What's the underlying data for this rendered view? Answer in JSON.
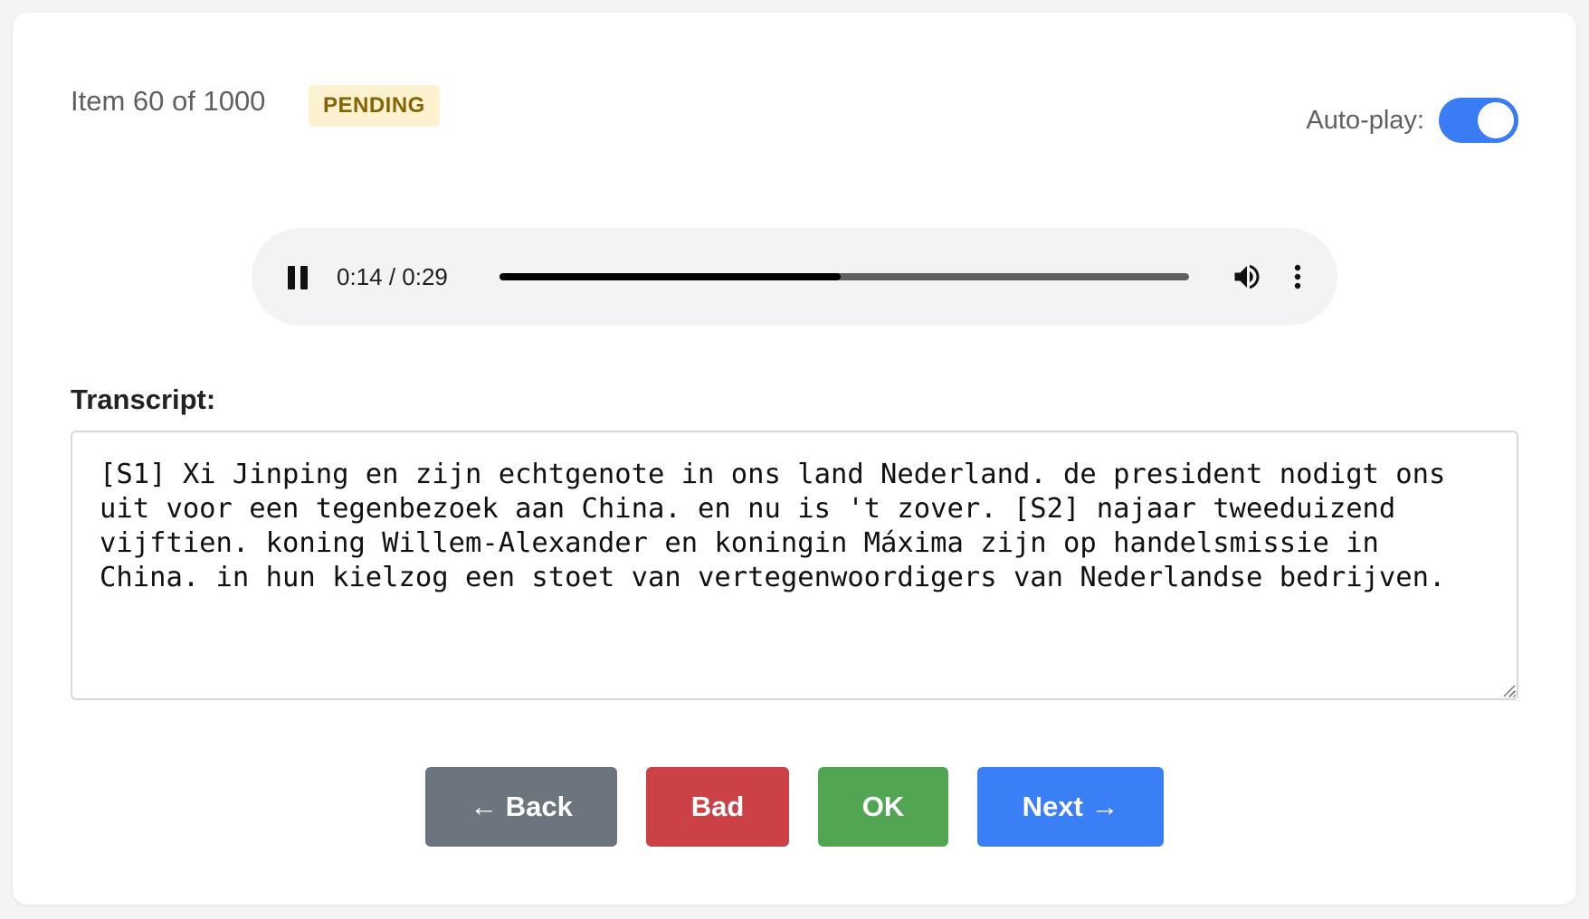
{
  "header": {
    "item_counter": "Item 60 of 1000",
    "status": "PENDING",
    "autoplay_label": "Auto-play:",
    "autoplay_on": true
  },
  "audio": {
    "time": "0:14 / 0:29",
    "progress": 0.4946
  },
  "transcript": {
    "label": "Transcript:",
    "text": "[S1] Xi Jinping en zijn echtgenote in ons land Nederland. de president nodigt ons uit voor een tegenbezoek aan China. en nu is 't zover. [S2] najaar tweeduizend vijftien. koning Willem-Alexander en koningin Máxima zijn op handelsmissie in China. in hun kielzog een stoet van vertegenwoordigers van Nederlandse bedrijven."
  },
  "actions": {
    "back": "← Back",
    "bad": "Bad",
    "ok": "OK",
    "next": "Next →"
  },
  "colors": {
    "accent": "#3a7cf6",
    "back": "#6c757d",
    "bad": "#cc4146",
    "ok": "#52a653",
    "next": "#3a7ff6",
    "badge_bg": "#fcf2cf",
    "badge_text": "#856404"
  }
}
